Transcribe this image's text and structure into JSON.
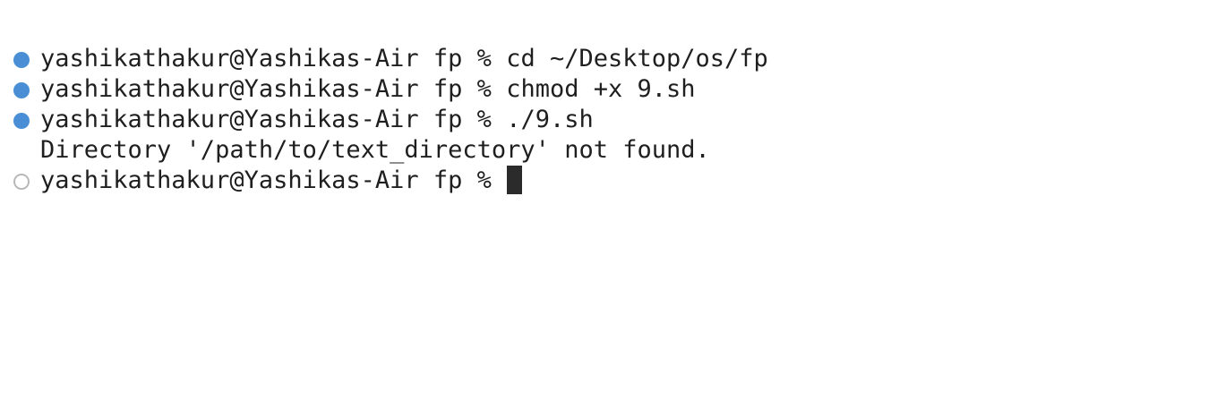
{
  "terminal": {
    "lines": [
      {
        "marker": "done",
        "prompt": "yashikathakur@Yashikas-Air fp %",
        "command": "cd ~/Desktop/os/fp"
      },
      {
        "marker": "done",
        "prompt": "yashikathakur@Yashikas-Air fp %",
        "command": "chmod +x 9.sh"
      },
      {
        "marker": "done",
        "prompt": "yashikathakur@Yashikas-Air fp %",
        "command": "./9.sh"
      },
      {
        "output": "Directory '/path/to/text_directory' not found."
      },
      {
        "marker": "pending",
        "prompt": "yashikathakur@Yashikas-Air fp %",
        "command": ""
      }
    ]
  },
  "colors": {
    "completed_marker": "#4a8fd6",
    "pending_marker": "#b8b8b8",
    "text": "#1f1f1f",
    "background": "#ffffff"
  }
}
